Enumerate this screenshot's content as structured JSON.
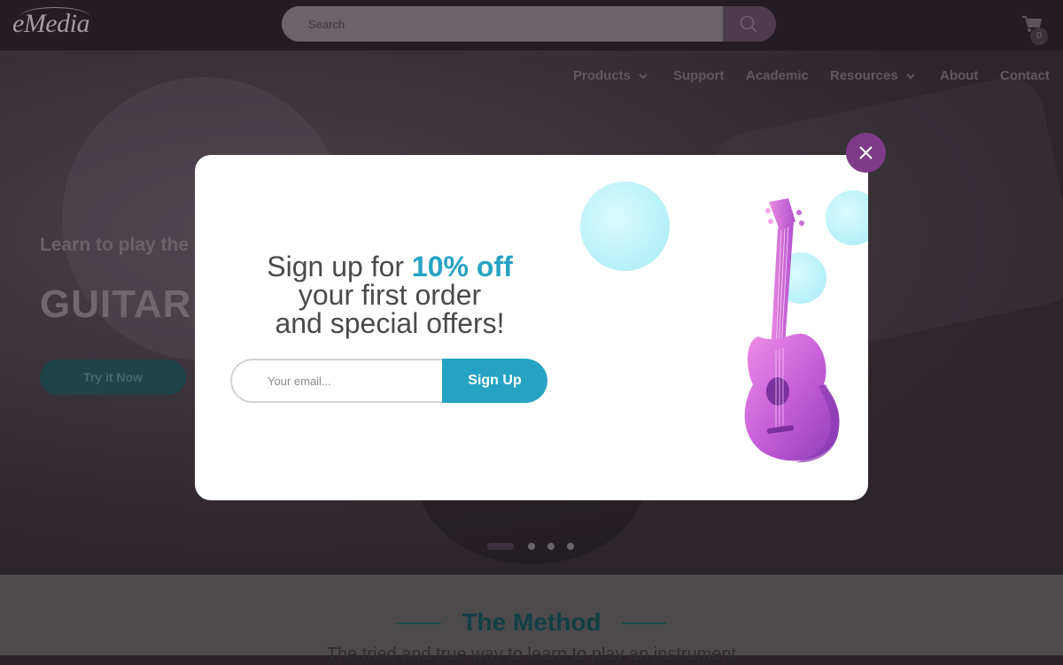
{
  "header": {
    "logo_text": "eMedia",
    "search_placeholder": "Search",
    "cart_count": "0"
  },
  "nav": {
    "items": [
      {
        "label": "Products",
        "has_dropdown": true
      },
      {
        "label": "Support",
        "has_dropdown": false
      },
      {
        "label": "Academic",
        "has_dropdown": false
      },
      {
        "label": "Resources",
        "has_dropdown": true
      },
      {
        "label": "About",
        "has_dropdown": false
      },
      {
        "label": "Contact",
        "has_dropdown": false
      }
    ]
  },
  "hero": {
    "subtitle": "Learn to play the",
    "title": "GUITAR",
    "cta_label": "Try it Now",
    "slide_count": 4,
    "active_slide": 1
  },
  "method": {
    "title": "The Method",
    "subtitle": "The tried and true way to learn to play an instrument"
  },
  "modal": {
    "headline_prefix": "Sign up for ",
    "headline_highlight": "10% off",
    "headline_line2": "your first order",
    "headline_line3": "and special offers!",
    "email_placeholder": "Your email...",
    "signup_label": "Sign Up"
  },
  "icons": {
    "close": "close-icon",
    "search": "search-icon",
    "cart": "cart-icon",
    "guitar": "guitar-illustration"
  },
  "colors": {
    "accent": "#26a3c2",
    "close_button": "#7e3b87",
    "method_title": "#123f44"
  }
}
